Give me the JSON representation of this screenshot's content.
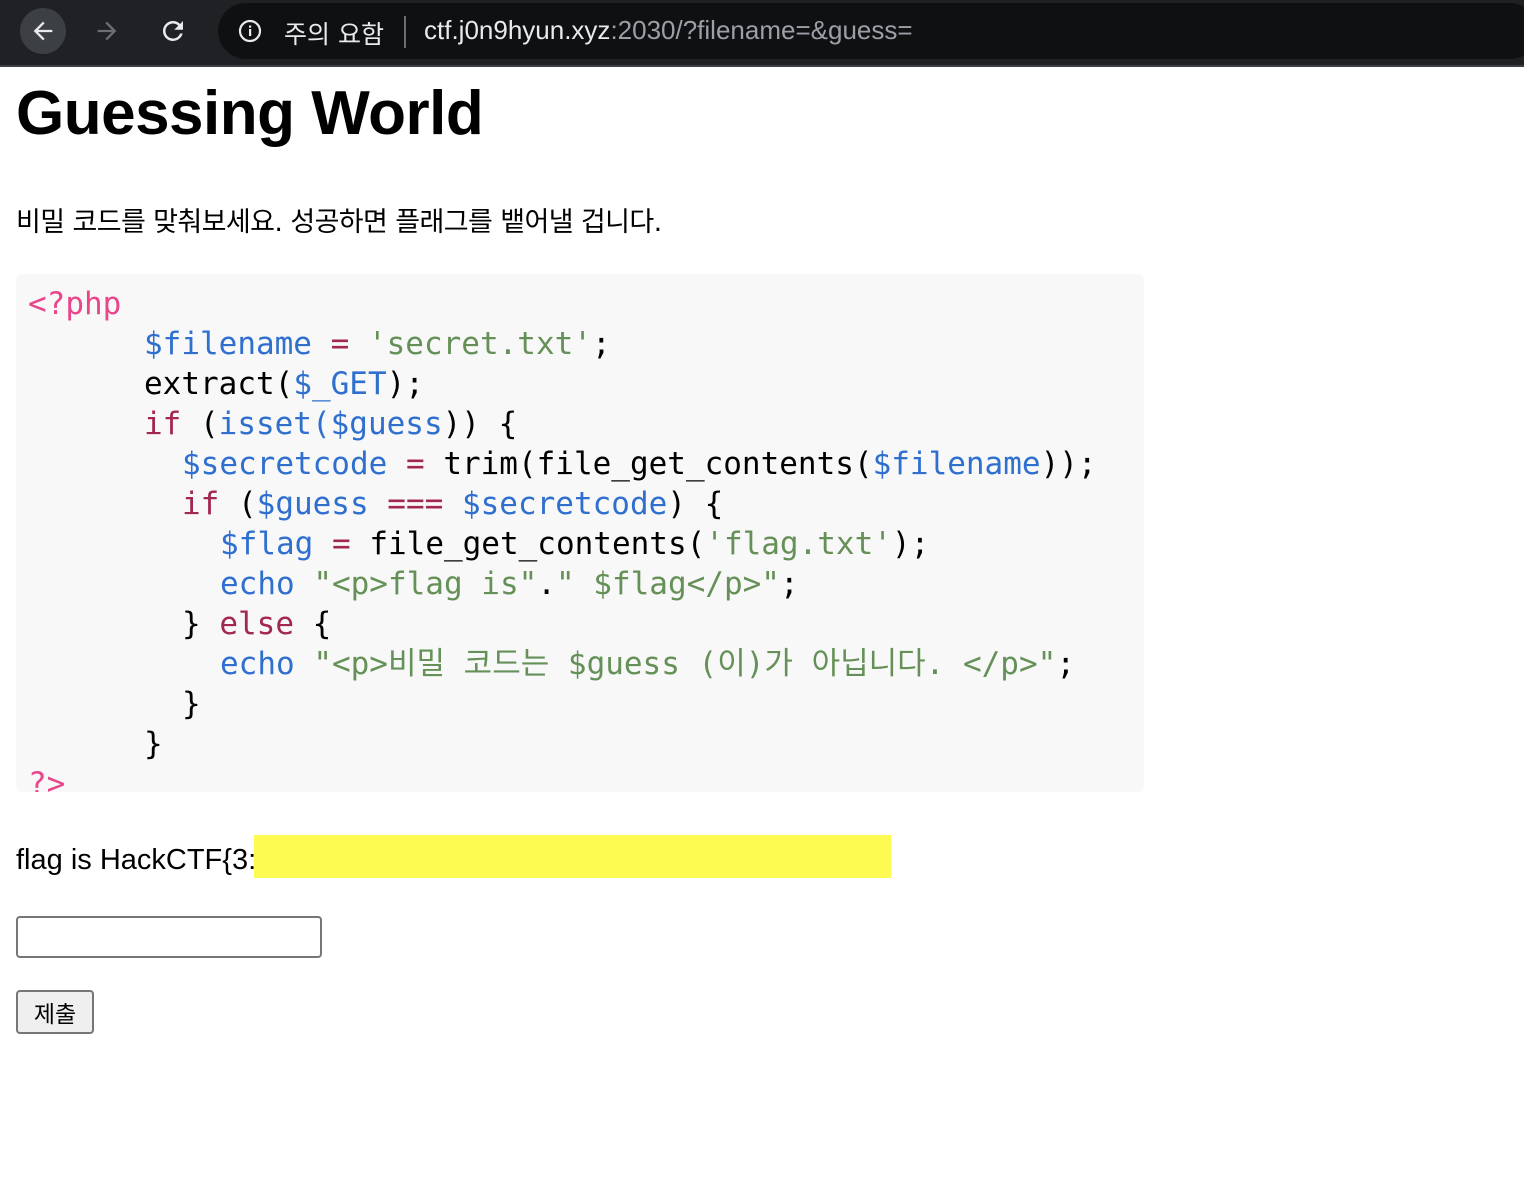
{
  "browser": {
    "security_label": "주의 요함",
    "url_host": "ctf.j0n9hyun.xyz",
    "url_rest": ":2030/?filename=&guess="
  },
  "page": {
    "title": "Guessing World",
    "intro": "비밀 코드를 맞춰보세요. 성공하면 플래그를 뱉어낼 겁니다.",
    "flag_text": "flag is HackCTF{3:",
    "submit_label": "제출",
    "input_value": ""
  },
  "code": {
    "open_tag": "<?php",
    "l2_var": "$filename",
    "l2_eq": " = ",
    "l2_str": "'secret.txt'",
    "l2_end": ";",
    "l3_fn": "extract(",
    "l3_var": "$_GET",
    "l3_end": ");",
    "l4_if": "if",
    "l4_a": " (",
    "l4_isset": "isset(",
    "l4_var": "$guess",
    "l4_end": ")) {",
    "l5_var": "$secretcode",
    "l5_eq": " = ",
    "l5_fn": "trim(file_get_contents(",
    "l5_var2": "$filename",
    "l5_end": "));",
    "l6_if": "if",
    "l6_a": " (",
    "l6_var": "$guess",
    "l6_op": " === ",
    "l6_var2": "$secretcode",
    "l6_end": ") {",
    "l7_var": "$flag",
    "l7_eq": " = ",
    "l7_fn": "file_get_contents(",
    "l7_str": "'flag.txt'",
    "l7_end": ");",
    "l8_echo": "echo",
    "l8_s1": " \"<p>flag is\"",
    "l8_dot": ".",
    "l8_s2": "\" $flag</p>\"",
    "l8_end": ";",
    "l9_a": "} ",
    "l9_else": "else",
    "l9_b": " {",
    "l10_echo": "echo",
    "l10_s": " \"<p>비밀 코드는 $guess (이)가 아닙니다. </p>\"",
    "l10_end": ";",
    "l11": "}",
    "l12": "}",
    "close_tag": "?>"
  },
  "colors": {
    "php_tag": "#e9458b",
    "variable": "#2f6fce",
    "string": "#659158",
    "control": "#a3284f",
    "redaction": "#fdfb52"
  },
  "icons": [
    "back-arrow-icon",
    "forward-arrow-icon",
    "reload-icon",
    "info-icon"
  ]
}
